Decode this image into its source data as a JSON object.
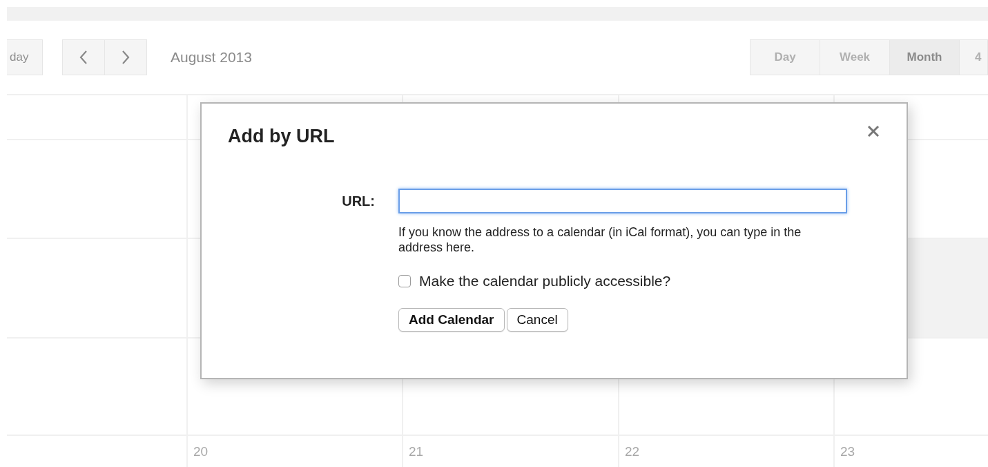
{
  "toolbar": {
    "today_button": "day",
    "month_title": "August 2013",
    "views": [
      {
        "label": "Day",
        "selected": false
      },
      {
        "label": "Week",
        "selected": false
      },
      {
        "label": "Month",
        "selected": true
      },
      {
        "label": "4",
        "selected": false
      }
    ]
  },
  "calendar": {
    "rows": [
      {
        "cells": [
          {
            "highlighted": false
          },
          {},
          {},
          {
            "highlighted": false
          }
        ]
      },
      {
        "cells": [
          {
            "highlighted": false
          },
          {},
          {},
          {
            "highlighted": true
          }
        ]
      },
      {
        "cells": [
          {
            "highlighted": false
          },
          {
            "highlighted": false
          },
          {
            "highlighted": false
          },
          {
            "highlighted": false
          }
        ]
      },
      {
        "cells": [
          {
            "day": "20",
            "highlighted": false
          },
          {
            "day": "21",
            "highlighted": false
          },
          {
            "day": "22",
            "highlighted": false
          },
          {
            "day": "23",
            "highlighted": false
          }
        ]
      }
    ]
  },
  "dialog": {
    "title": "Add by URL",
    "url_label": "URL:",
    "url_field": {
      "focused": true
    },
    "help": "If you know the address to a calendar (in iCal format), you can type in the address here.",
    "checkbox": {
      "label": "Make the calendar publicly accessible?",
      "checked": false
    },
    "buttons": [
      {
        "label": "Add Calendar",
        "kind": "primary"
      },
      {
        "label": "Cancel",
        "kind": "default"
      }
    ]
  }
}
